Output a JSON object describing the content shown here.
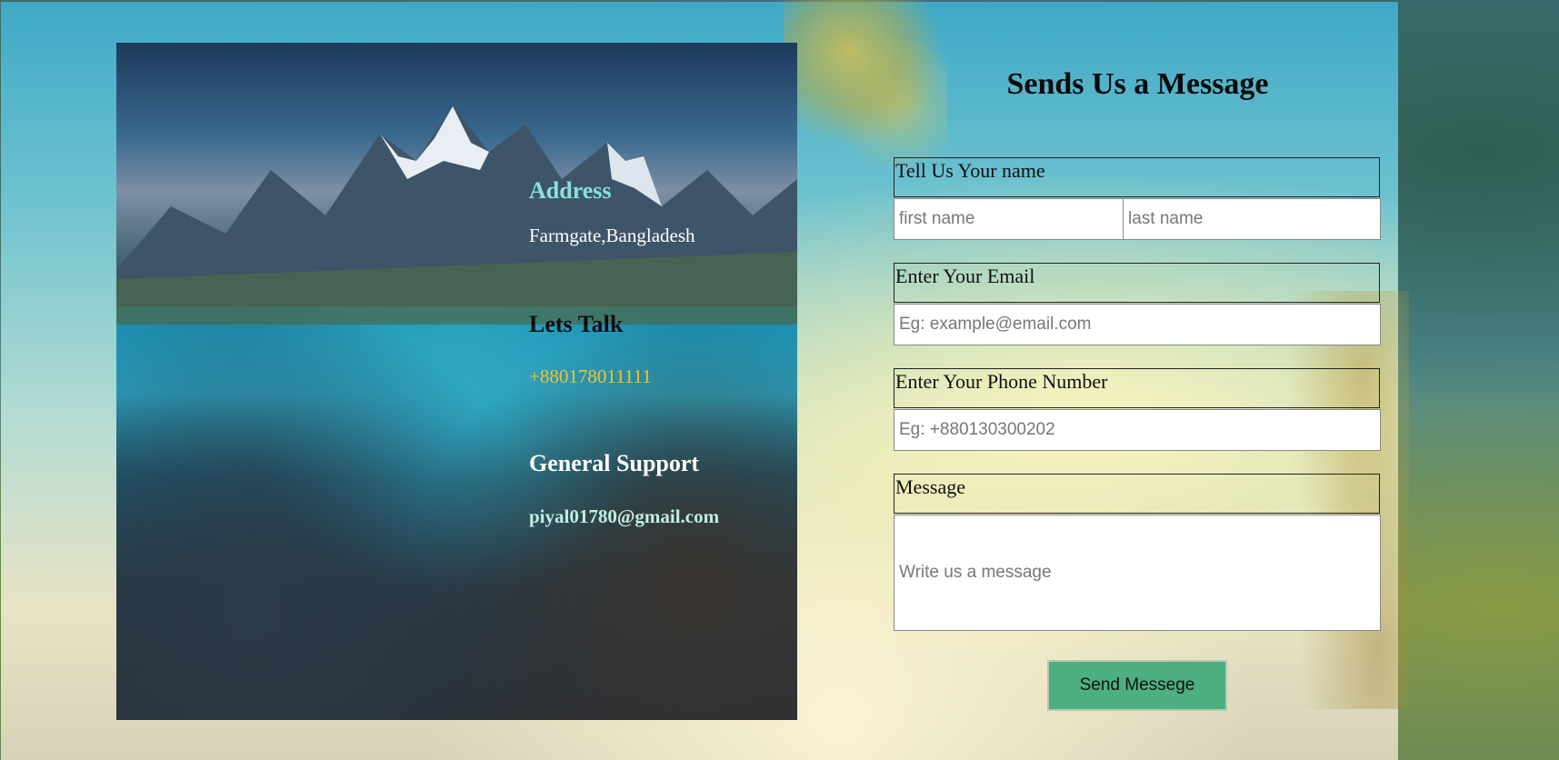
{
  "contact_info": {
    "address_heading": "Address",
    "address_value": "Farmgate,Bangladesh",
    "talk_heading": "Lets Talk",
    "phone_value": "+880178011111",
    "support_heading": "General Support",
    "email_value": "piyal01780@gmail.com"
  },
  "form": {
    "title": "Sends Us a Message",
    "name_label": "Tell Us Your name",
    "first_name_placeholder": "first name",
    "last_name_placeholder": "last name",
    "email_label": "Enter Your Email",
    "email_placeholder": "Eg: example@email.com",
    "phone_label": "Enter Your Phone Number",
    "phone_placeholder": "Eg: +880130300202",
    "message_label": "Message",
    "message_placeholder": "Write us a message",
    "submit_label": "Send Messege"
  },
  "colors": {
    "address_heading": "#8de0dc",
    "phone_value": "#f2c430",
    "submit_button": "#4caf80"
  }
}
